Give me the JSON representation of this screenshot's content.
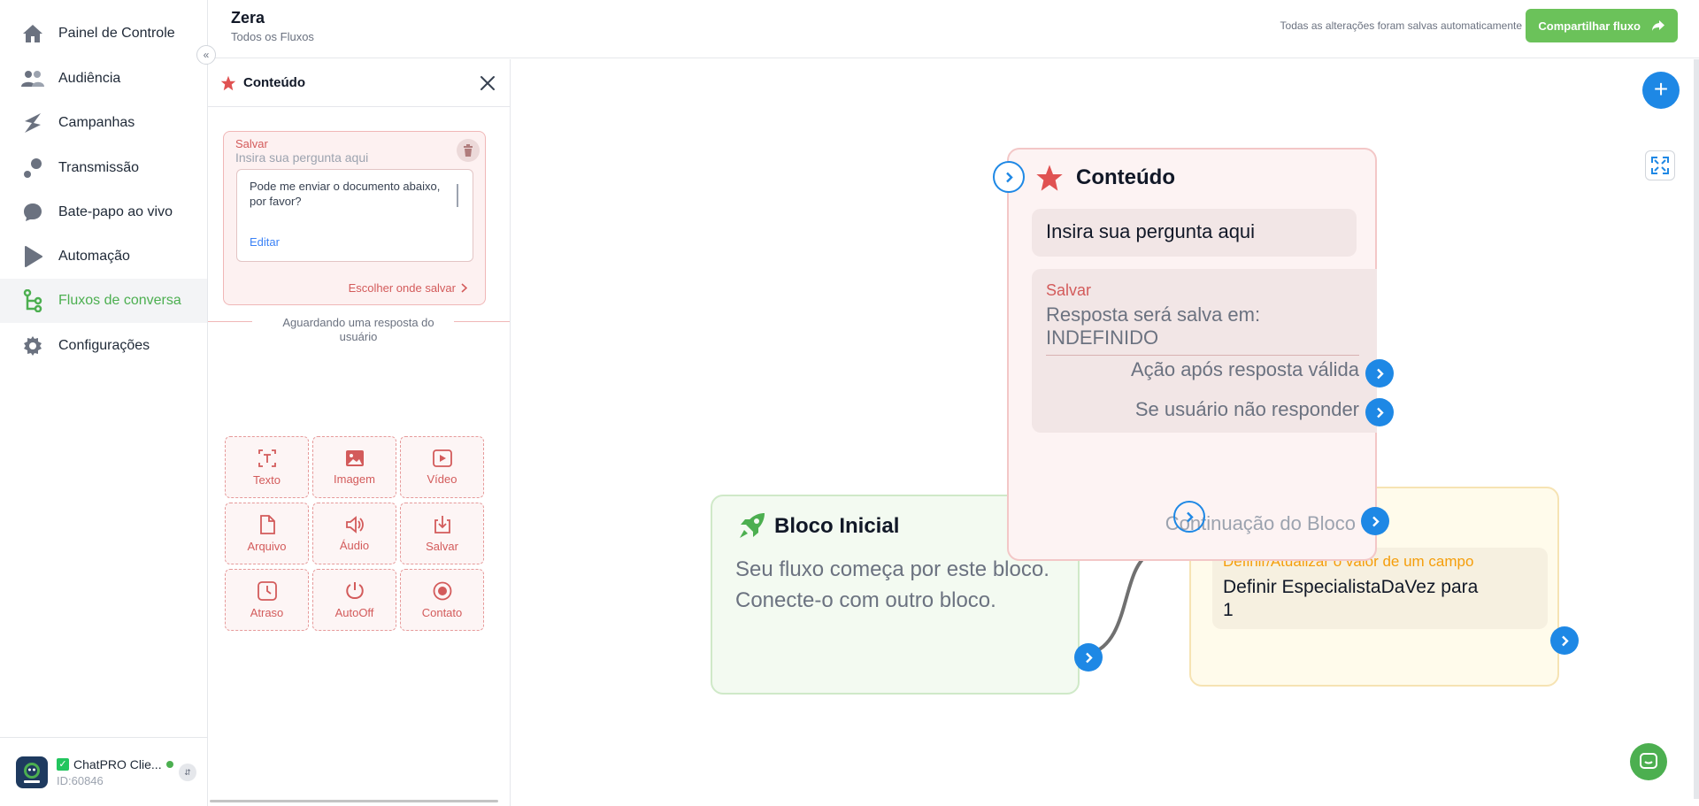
{
  "sidebar": {
    "items": [
      {
        "label": "Painel de Controle"
      },
      {
        "label": "Audiência"
      },
      {
        "label": "Campanhas"
      },
      {
        "label": "Transmissão"
      },
      {
        "label": "Bate-papo ao vivo"
      },
      {
        "label": "Automação"
      },
      {
        "label": "Fluxos de conversa"
      },
      {
        "label": "Configurações"
      }
    ],
    "active_item": "Fluxos de conversa",
    "account": {
      "name": "ChatPRO Clie...",
      "id": "ID:60846",
      "logo_text": "ChatPRO"
    }
  },
  "header": {
    "flow_name": "Zera",
    "breadcrumb": "Todos os Fluxos",
    "save_status": "Todas as alterações foram salvas automaticamente",
    "share_label": "Compartilhar fluxo"
  },
  "panel": {
    "title": "Conteúdo",
    "save_card": {
      "label": "Salvar",
      "placeholder": "Insira sua pergunta aqui",
      "message": "Pode me enviar o documento abaixo, por favor?",
      "edit_label": "Editar",
      "choose_save_label": "Escolher onde salvar"
    },
    "awaiting_text": "Aguardando uma resposta do usuário",
    "tools": [
      {
        "label": "Texto",
        "icon": "text-icon"
      },
      {
        "label": "Imagem",
        "icon": "image-icon"
      },
      {
        "label": "Vídeo",
        "icon": "video-icon"
      },
      {
        "label": "Arquivo",
        "icon": "file-icon"
      },
      {
        "label": "Áudio",
        "icon": "audio-icon"
      },
      {
        "label": "Salvar",
        "icon": "save-icon"
      },
      {
        "label": "Atraso",
        "icon": "clock-icon"
      },
      {
        "label": "AutoOff",
        "icon": "power-icon"
      },
      {
        "label": "Contato",
        "icon": "contact-icon"
      }
    ]
  },
  "canvas": {
    "start_node": {
      "title": "Bloco Inicial",
      "description": "Seu fluxo começa por este bloco. Conecte-o com outro bloco."
    },
    "content_node": {
      "title": "Conteúdo",
      "question": "Insira sua pergunta aqui",
      "save_label": "Salvar",
      "save_value": "Resposta será salva em: INDEFINIDO",
      "action_valid": "Ação após resposta válida",
      "action_no_reply": "Se usuário não responder",
      "continuation": "Continuação do Bloco"
    },
    "set_node": {
      "label": "Definir/Atualizar o valor de um campo",
      "value": "Definir EspecialistaDaVez para 1"
    }
  },
  "colors": {
    "accent_green": "#4caf50",
    "share_button": "#6bc25a",
    "port_blue": "#1e88e5",
    "content_red": "#d35b5b",
    "set_orange": "#f59e0b"
  }
}
